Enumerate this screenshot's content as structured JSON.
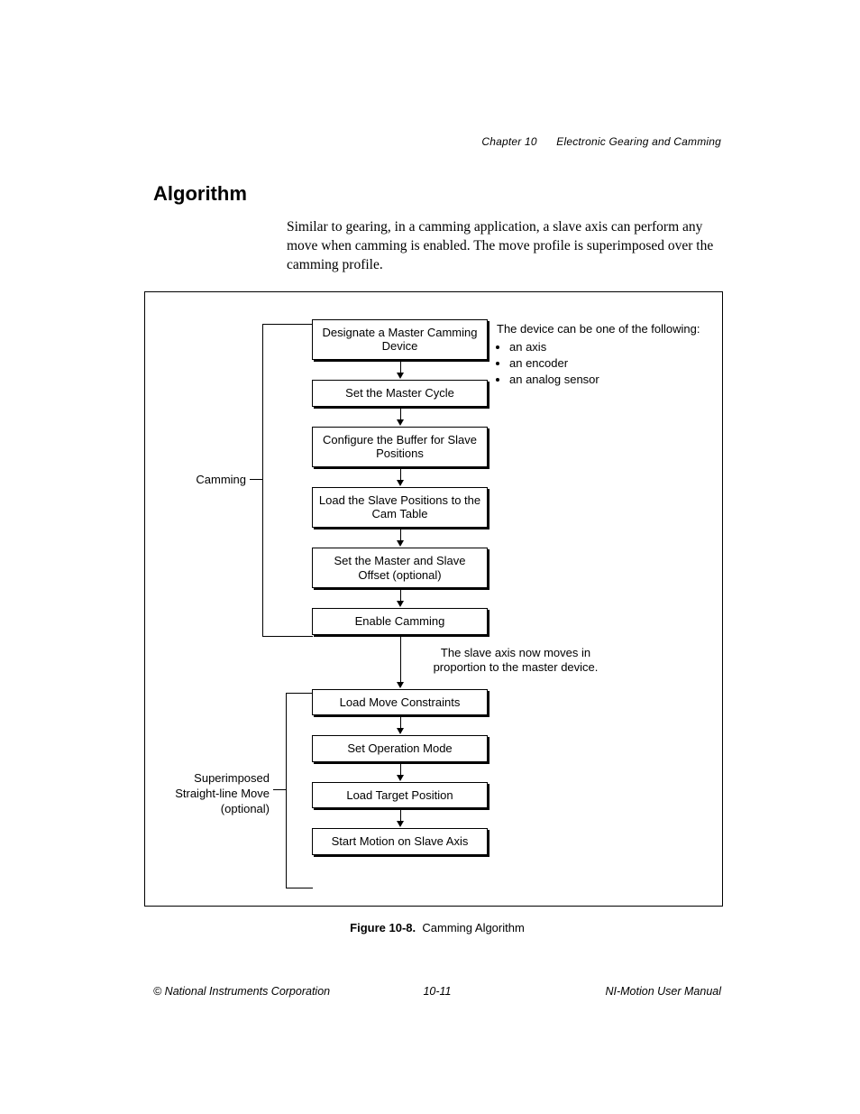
{
  "header": {
    "chapter": "Chapter 10",
    "title": "Electronic Gearing and Camming"
  },
  "heading": "Algorithm",
  "paragraph": "Similar to gearing, in a camming application, a slave axis can perform any move when camming is enabled. The move profile is superimposed over the camming profile.",
  "flow": {
    "boxes": [
      "Designate a Master Camming Device",
      "Set the Master Cycle",
      "Configure the Buffer for Slave Positions",
      "Load the Slave Positions to the Cam Table",
      "Set the Master and Slave Offset (optional)",
      "Enable Camming",
      "Load Move Constraints",
      "Set Operation Mode",
      "Load Target Position",
      "Start Motion on Slave Axis"
    ],
    "mid_note_line1": "The slave axis now moves in",
    "mid_note_line2": "proportion to the master device.",
    "left_label_1": "Camming",
    "left_label_2_line1": "Superimposed",
    "left_label_2_line2": "Straight-line Move",
    "left_label_2_line3": "(optional)",
    "side_note_title": "The device can be one of the following:",
    "side_note_items": [
      "an axis",
      "an encoder",
      "an analog sensor"
    ]
  },
  "caption_label": "Figure 10-8.",
  "caption_text": "Camming Algorithm",
  "footer": {
    "left": "© National Instruments Corporation",
    "center": "10-11",
    "right": "NI-Motion User Manual"
  }
}
